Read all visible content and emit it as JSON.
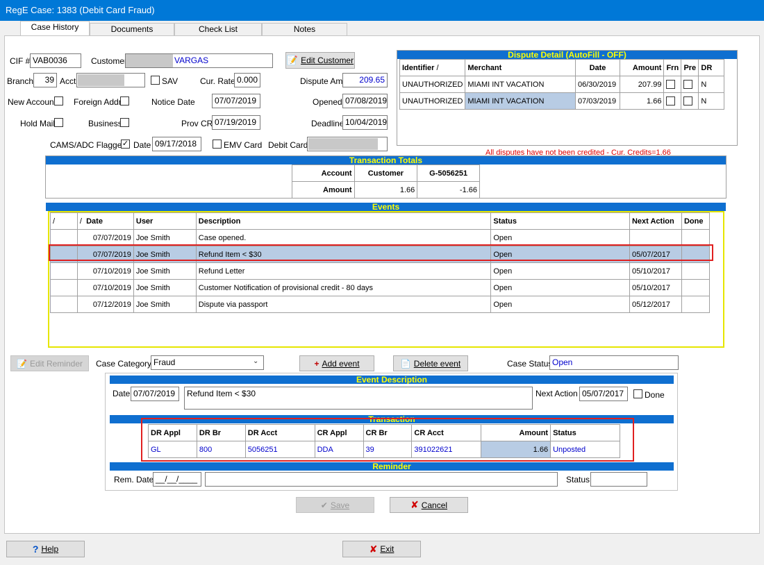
{
  "window": {
    "title": "RegE Case: 1383 (Debit Card Fraud)"
  },
  "tabs": [
    "Case History",
    "Documents",
    "Check List",
    "Notes"
  ],
  "customer": {
    "cif_label": "CIF #",
    "cif": "VAB0036",
    "customer_label": "Customer",
    "customer_name": "VARGAS",
    "edit_customer": "Edit Customer",
    "branch_label": "Branch",
    "branch": "39",
    "acct_label": "Acct",
    "sav_label": "SAV",
    "cur_rate_label": "Cur. Rate",
    "cur_rate": "0.000",
    "dispute_amt_label": "Dispute Amt",
    "dispute_amt": "209.65",
    "new_account_label": "New Account",
    "foreign_addr_label": "Foreign Addr",
    "notice_date_label": "Notice Date",
    "notice_date": "07/07/2019",
    "opened_label": "Opened",
    "opened": "07/08/2019",
    "hold_mail_label": "Hold Mail",
    "business_label": "Business",
    "prov_cr_label": "Prov CR",
    "prov_cr": "07/19/2019",
    "deadline_label": "Deadline",
    "deadline": "10/04/2019",
    "cams_label": "CAMS/ADC Flagged",
    "cams_check": "✓",
    "date_label": "Date",
    "cams_date": "09/17/2018",
    "emv_label": "EMV Card",
    "debit_card_label": "Debit Card"
  },
  "dispute_detail": {
    "title": "Dispute Detail (AutoFill - OFF)",
    "columns": [
      "Identifier",
      "Merchant",
      "Date",
      "Amount",
      "Frn",
      "Pre",
      "DR"
    ],
    "sort_glyph": "/",
    "rows": [
      {
        "identifier": "UNAUTHORIZED",
        "merchant": "MIAMI INT VACATION",
        "date": "06/30/2019",
        "amount": "207.99",
        "dr": "N"
      },
      {
        "identifier": "UNAUTHORIZED",
        "merchant": "MIAMI INT VACATION",
        "date": "07/03/2019",
        "amount": "1.66",
        "dr": "N"
      }
    ],
    "warning": "All disputes have not been credited - Cur. Credits=1.66"
  },
  "transaction_totals": {
    "title": "Transaction Totals",
    "headers": [
      "Account",
      "Customer",
      "G-5056251"
    ],
    "row_label": "Amount",
    "values": [
      "1.66",
      "-1.66"
    ]
  },
  "events": {
    "title": "Events",
    "sort_glyph": "/",
    "columns": [
      "Date",
      "User",
      "Description",
      "Status",
      "Next Action",
      "Done"
    ],
    "rows": [
      {
        "date": "07/07/2019",
        "user": "Joe Smith",
        "description": "Case opened.",
        "status": "Open",
        "next_action": ""
      },
      {
        "date": "07/07/2019",
        "user": "Joe Smith",
        "description": "Refund Item < $30",
        "status": "Open",
        "next_action": "05/07/2017"
      },
      {
        "date": "07/10/2019",
        "user": "Joe Smith",
        "description": "Refund Letter",
        "status": "Open",
        "next_action": "05/10/2017"
      },
      {
        "date": "07/10/2019",
        "user": "Joe Smith",
        "description": "Customer Notification of provisional credit - 80 days",
        "status": "Open",
        "next_action": "05/10/2017"
      },
      {
        "date": "07/12/2019",
        "user": "Joe Smith",
        "description": "Dispute via passport",
        "status": "Open",
        "next_action": "05/12/2017"
      }
    ]
  },
  "actions": {
    "edit_reminder": "Edit Reminder",
    "case_category_label": "Case Category",
    "case_category": "Fraud",
    "add_event": "Add event",
    "delete_event": "Delete event",
    "case_status_label": "Case Status",
    "case_status": "Open"
  },
  "event_description": {
    "title": "Event Description",
    "date_label": "Date",
    "date": "07/07/2019",
    "description": "Refund Item < $30",
    "next_action_label": "Next Action",
    "next_action": "05/07/2017",
    "done_label": "Done"
  },
  "transaction": {
    "title": "Transaction",
    "columns": [
      "DR Appl",
      "DR Br",
      "DR Acct",
      "CR Appl",
      "CR Br",
      "CR Acct",
      "Amount",
      "Status"
    ],
    "row": [
      "GL",
      "800",
      "5056251",
      "DDA",
      "39",
      "391022621",
      "1.66",
      "Unposted"
    ]
  },
  "reminder": {
    "title": "Reminder",
    "rem_date_label": "Rem. Date",
    "rem_date": "__/__/____",
    "status_label": "Status"
  },
  "footer": {
    "save": "Save",
    "cancel": "Cancel",
    "help": "Help",
    "exit": "Exit"
  },
  "colors": {
    "title_bar": "#0078d7",
    "section_header": "#0f6fd0",
    "section_text": "#ffff00",
    "highlight_row": "#b8cce4",
    "annotation": "#e00000",
    "field_text_blue": "#0000cc"
  }
}
